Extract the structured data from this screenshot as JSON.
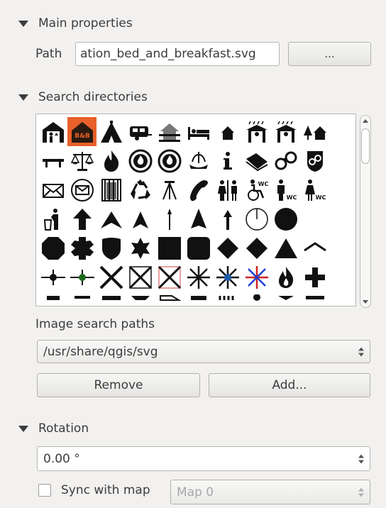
{
  "main_properties": {
    "title": "Main properties",
    "path_label": "Path",
    "path_value": "ation_bed_and_breakfast.svg",
    "browse_label": "..."
  },
  "search_directories": {
    "title": "Search directories",
    "icons": [
      [
        "elevator-icon",
        "bed-and-breakfast-icon",
        "tent-icon",
        "caravan-icon",
        "chalet-icon",
        "bed-icon",
        "house-icon",
        "shelter-rain-icon",
        "shelter-rain-icon",
        "trees-house-icon"
      ],
      [
        "bench-icon",
        "scales-icon",
        "fire-icon",
        "fire-badge-icon",
        "fire-badge-icon",
        "fountain-icon",
        "info-icon",
        "book-icon",
        "handcuffs-icon",
        "handcuffs-badge-icon"
      ],
      [
        "mail-icon",
        "mail-circle-icon",
        "prison-icon",
        "recycle-icon",
        "survey-point-icon",
        "telephone-icon",
        "toilets-icon",
        "wheelchair-wc-icon",
        "male-wc-icon",
        "female-wc-icon"
      ],
      [
        "waste-basket-icon",
        "arrow-up-thick-icon",
        "arrow-head-icon",
        "arrow-head-narrow-icon",
        "arrow-thin-icon",
        "arrow-triangle-icon",
        "arrow-up-icon",
        "clock-circle-icon",
        "filled-circle-icon",
        ""
      ],
      [
        "octagon-icon",
        "cross-octagon-icon",
        "shield-icon",
        "star-icon",
        "square-icon",
        "rounded-square-icon",
        "diamond-icon",
        "diamond-icon",
        "triangle-icon",
        "chevron-line-icon"
      ],
      [
        "line-dot-icon",
        "line-green-dot-icon",
        "x-cross-icon",
        "x-box-icon",
        "x-box-red-icon",
        "asterisk-icon",
        "asterisk-blue-icon",
        "asterisk-red-blue-icon",
        "fire-outline-icon",
        "plus-icon"
      ],
      [
        "misc-icon",
        "misc-icon",
        "misc-icon",
        "misc-icon",
        "misc-icon",
        "misc-icon",
        "misc-icon",
        "misc-icon",
        "misc-icon",
        "misc-icon"
      ]
    ],
    "selected_icon": "bed-and-breakfast-icon",
    "selected_text": "B&B",
    "accent_color": "#e9602a"
  },
  "image_search_paths": {
    "label": "Image search paths",
    "selected": "/usr/share/qgis/svg",
    "remove_label": "Remove",
    "add_label": "Add..."
  },
  "rotation": {
    "title": "Rotation",
    "value": "0.00 °",
    "sync_label": "Sync with map",
    "sync_checked": false,
    "map_value": "Map 0"
  }
}
